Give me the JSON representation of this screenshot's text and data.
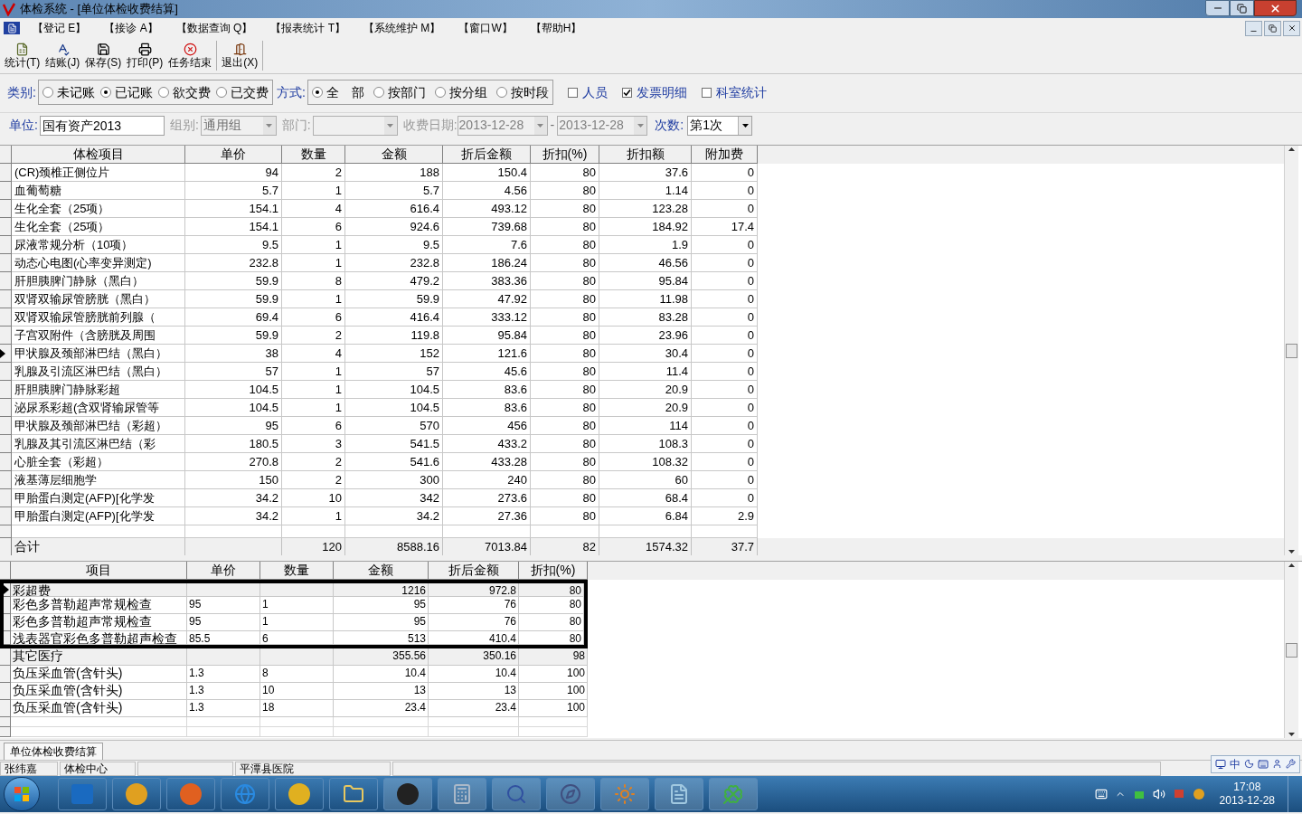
{
  "window": {
    "title": "体检系统 - [单位体检收费结算]"
  },
  "menu": [
    "【登记 E】",
    "【接诊 A】",
    "【数据查询 Q】",
    "【报表统计 T】",
    "【系统维护 M】",
    "【窗口W】",
    "【帮助H】"
  ],
  "toolbar": [
    {
      "kind": "stats",
      "label": "统计(T)"
    },
    {
      "kind": "settle",
      "label": "结账(J)"
    },
    {
      "kind": "save",
      "label": "保存(S)"
    },
    {
      "kind": "print",
      "label": "打印(P)"
    },
    {
      "kind": "stop",
      "label": "任务结束"
    },
    {
      "kind": "exit",
      "label": "退出(X)"
    }
  ],
  "category": {
    "label": "类别:",
    "options": [
      {
        "label": "未记账",
        "selected": false
      },
      {
        "label": "已记账",
        "selected": true
      },
      {
        "label": "欲交费",
        "selected": false
      },
      {
        "label": "已交费",
        "selected": false
      }
    ]
  },
  "mode": {
    "label": "方式:",
    "options": [
      {
        "label": "全　部",
        "selected": true
      },
      {
        "label": "按部门",
        "selected": false
      },
      {
        "label": "按分组",
        "selected": false
      },
      {
        "label": "按时段",
        "selected": false
      }
    ]
  },
  "checks": [
    {
      "label": "人员",
      "checked": false
    },
    {
      "label": "发票明细",
      "checked": true
    },
    {
      "label": "科室统计",
      "checked": false
    }
  ],
  "form": {
    "unit": {
      "label": "单位:",
      "value": "国有资产2013"
    },
    "group": {
      "label": "组别:",
      "value": "通用组",
      "disabled": true
    },
    "dept": {
      "label": "部门:",
      "disabled": true
    },
    "date": {
      "label": "收费日期:",
      "from": "2013-12-28",
      "sep": "-",
      "to": "2013-12-28",
      "disabled": true
    },
    "times": {
      "label": "次数:",
      "value": "第1次"
    }
  },
  "main_table": {
    "columns": [
      "体检项目",
      "单价",
      "数量",
      "金额",
      "折后金额",
      "折扣(%)",
      "折扣额",
      "附加费"
    ],
    "rows": [
      {
        "current": false,
        "cells": [
          "(CR)颈椎正侧位片",
          "94",
          "2",
          "188",
          "150.4",
          "80",
          "37.6",
          "0"
        ]
      },
      {
        "current": false,
        "cells": [
          "血葡萄糖",
          "5.7",
          "1",
          "5.7",
          "4.56",
          "80",
          "1.14",
          "0"
        ]
      },
      {
        "current": false,
        "cells": [
          "生化全套（25项）",
          "154.1",
          "4",
          "616.4",
          "493.12",
          "80",
          "123.28",
          "0"
        ]
      },
      {
        "current": false,
        "cells": [
          "生化全套（25项）",
          "154.1",
          "6",
          "924.6",
          "739.68",
          "80",
          "184.92",
          "17.4"
        ]
      },
      {
        "current": false,
        "cells": [
          "尿液常规分析（10项）",
          "9.5",
          "1",
          "9.5",
          "7.6",
          "80",
          "1.9",
          "0"
        ]
      },
      {
        "current": false,
        "cells": [
          "动态心电图(心率变异测定)",
          "232.8",
          "1",
          "232.8",
          "186.24",
          "80",
          "46.56",
          "0"
        ]
      },
      {
        "current": false,
        "cells": [
          "肝胆胰脾门静脉（黑白）",
          "59.9",
          "8",
          "479.2",
          "383.36",
          "80",
          "95.84",
          "0"
        ]
      },
      {
        "current": false,
        "cells": [
          "双肾双输尿管膀胱（黑白）",
          "59.9",
          "1",
          "59.9",
          "47.92",
          "80",
          "11.98",
          "0"
        ]
      },
      {
        "current": false,
        "cells": [
          "双肾双输尿管膀胱前列腺（",
          "69.4",
          "6",
          "416.4",
          "333.12",
          "80",
          "83.28",
          "0"
        ]
      },
      {
        "current": false,
        "cells": [
          "子宫双附件（含膀胱及周围",
          "59.9",
          "2",
          "119.8",
          "95.84",
          "80",
          "23.96",
          "0"
        ]
      },
      {
        "current": true,
        "cells": [
          "甲状腺及颈部淋巴结（黑白）",
          "38",
          "4",
          "152",
          "121.6",
          "80",
          "30.4",
          "0"
        ]
      },
      {
        "current": false,
        "cells": [
          "乳腺及引流区淋巴结（黑白）",
          "57",
          "1",
          "57",
          "45.6",
          "80",
          "11.4",
          "0"
        ]
      },
      {
        "current": false,
        "cells": [
          "肝胆胰脾门静脉彩超",
          "104.5",
          "1",
          "104.5",
          "83.6",
          "80",
          "20.9",
          "0"
        ]
      },
      {
        "current": false,
        "cells": [
          "泌尿系彩超(含双肾输尿管等",
          "104.5",
          "1",
          "104.5",
          "83.6",
          "80",
          "20.9",
          "0"
        ]
      },
      {
        "current": false,
        "cells": [
          "甲状腺及颈部淋巴结（彩超）",
          "95",
          "6",
          "570",
          "456",
          "80",
          "114",
          "0"
        ]
      },
      {
        "current": false,
        "cells": [
          "乳腺及其引流区淋巴结（彩",
          "180.5",
          "3",
          "541.5",
          "433.2",
          "80",
          "108.3",
          "0"
        ]
      },
      {
        "current": false,
        "cells": [
          "心脏全套（彩超）",
          "270.8",
          "2",
          "541.6",
          "433.28",
          "80",
          "108.32",
          "0"
        ]
      },
      {
        "current": false,
        "cells": [
          "液基薄层细胞学",
          "150",
          "2",
          "300",
          "240",
          "80",
          "60",
          "0"
        ]
      },
      {
        "current": false,
        "cells": [
          "甲胎蛋白测定(AFP)[化学发",
          "34.2",
          "10",
          "342",
          "273.6",
          "80",
          "68.4",
          "0"
        ]
      },
      {
        "current": false,
        "cells": [
          "甲胎蛋白测定(AFP)[化学发",
          "34.2",
          "1",
          "34.2",
          "27.36",
          "80",
          "6.84",
          "2.9"
        ]
      }
    ],
    "total": {
      "label": "合计",
      "cells": [
        "120",
        "8588.16",
        "7013.84",
        "82",
        "1574.32",
        "37.7"
      ]
    }
  },
  "detail_table": {
    "columns": [
      "项目",
      "单价",
      "数量",
      "金额",
      "折后金额",
      "折扣(%)"
    ],
    "rows": [
      {
        "kind": "group",
        "current": true,
        "outlined": true,
        "cells": [
          "彩超费",
          "1216",
          "972.8",
          "80"
        ]
      },
      {
        "kind": "item",
        "current": false,
        "outlined": true,
        "cells": [
          "彩色多普勒超声常规检查",
          "95",
          "1",
          "95",
          "76",
          "80"
        ]
      },
      {
        "kind": "item",
        "current": false,
        "outlined": true,
        "cells": [
          "彩色多普勒超声常规检查",
          "95",
          "1",
          "95",
          "76",
          "80"
        ]
      },
      {
        "kind": "item",
        "current": false,
        "outlined": true,
        "cells": [
          "浅表器官彩色多普勒超声检查",
          "85.5",
          "6",
          "513",
          "410.4",
          "80"
        ]
      },
      {
        "kind": "group",
        "current": false,
        "outlined": false,
        "cells": [
          "其它医疗",
          "355.56",
          "350.16",
          "98"
        ]
      },
      {
        "kind": "item",
        "current": false,
        "outlined": false,
        "cells": [
          "负压采血管(含针头)",
          "1.3",
          "8",
          "10.4",
          "10.4",
          "100"
        ]
      },
      {
        "kind": "item",
        "current": false,
        "outlined": false,
        "cells": [
          "负压采血管(含针头)",
          "1.3",
          "10",
          "13",
          "13",
          "100"
        ]
      },
      {
        "kind": "item",
        "current": false,
        "outlined": false,
        "cells": [
          "负压采血管(含针头)",
          "1.3",
          "18",
          "23.4",
          "23.4",
          "100"
        ]
      }
    ]
  },
  "window_tabs": [
    {
      "label": "单位体检收费结算",
      "selected": true
    }
  ],
  "status_bar": [
    "张纬嘉",
    "体检中心",
    "平潭县医院"
  ],
  "language_bar": {
    "label": "中"
  },
  "clock": {
    "time": "17:08",
    "date": "2013-12-28"
  }
}
